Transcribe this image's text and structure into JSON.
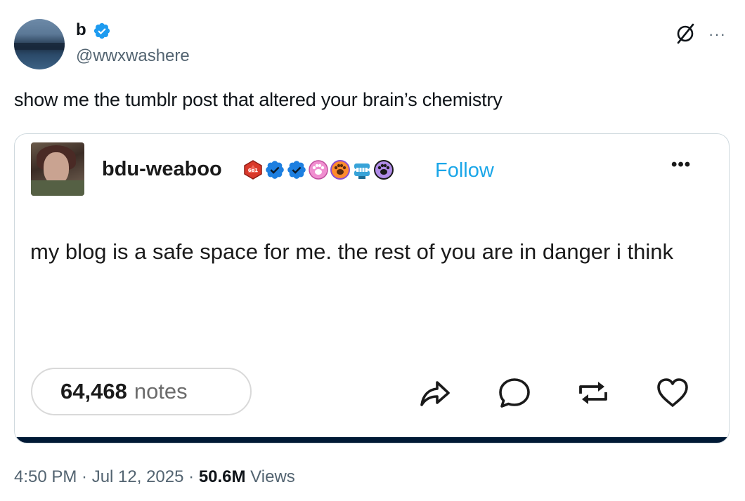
{
  "tweet": {
    "author": {
      "display_name": "b",
      "handle": "@wwxwashere",
      "verified": true
    },
    "text": "show me the tumblr post that altered your brain’s chemistry",
    "timestamp": "4:50 PM · Jul 12, 2025 · ",
    "views_count": "50.6M",
    "views_label": " Views"
  },
  "quoted_post": {
    "blog_name": "bdu-weaboo",
    "badge_icons": [
      "d20-badge-icon",
      "blue-check-badge-icon",
      "blue-check-badge-icon",
      "pink-paw-badge-icon",
      "orange-paw-badge-icon",
      "chattering-teeth-badge-icon",
      "purple-paw-badge-icon"
    ],
    "follow_label": "Follow",
    "more_label": "•••",
    "body": "my blog is a safe space for me. the rest of you are in danger i think",
    "notes_count": "64,468",
    "notes_label": "notes",
    "actions": [
      "share-icon",
      "reply-icon",
      "reblog-icon",
      "like-icon"
    ]
  },
  "header_icons": {
    "grok": "grok-icon",
    "more": "···"
  },
  "colors": {
    "verified_blue": "#1d9bf0",
    "tumblr_follow": "#1aa6e8",
    "muted_text": "#536471",
    "card_bottom_bar": "#001935"
  }
}
